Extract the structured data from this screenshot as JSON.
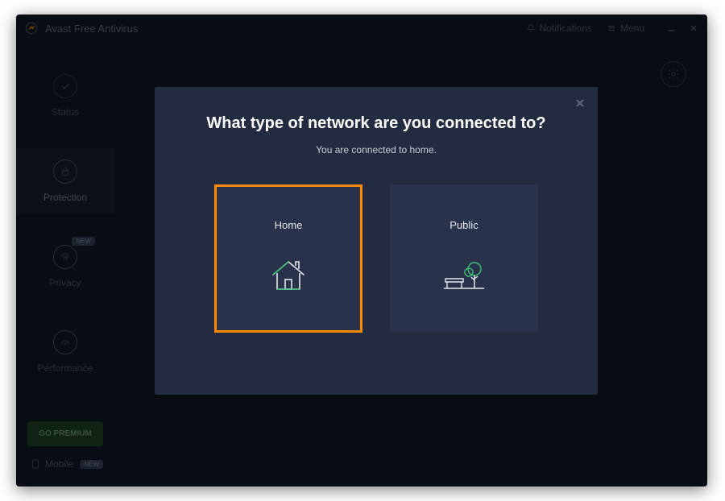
{
  "titlebar": {
    "app_name": "Avast Free Antivirus",
    "notifications_label": "Notifications",
    "menu_label": "Menu"
  },
  "sidebar": {
    "items": [
      {
        "label": "Status",
        "icon": "check-icon"
      },
      {
        "label": "Protection",
        "icon": "lock-icon"
      },
      {
        "label": "Privacy",
        "icon": "fingerprint-icon",
        "badge": "NEW"
      },
      {
        "label": "Performance",
        "icon": "gauge-icon"
      }
    ],
    "premium_label": "GO PREMIUM",
    "mobile_label": "Mobile",
    "mobile_badge": "NEW"
  },
  "modal": {
    "title": "What type of network are you connected to?",
    "subtitle": "You are connected to home.",
    "options": [
      {
        "label": "Home",
        "selected": true
      },
      {
        "label": "Public",
        "selected": false
      }
    ]
  },
  "colors": {
    "accent": "#ff8a00",
    "modal_bg": "#222b3f",
    "card_bg": "#28324a",
    "app_bg": "#0e1521"
  }
}
